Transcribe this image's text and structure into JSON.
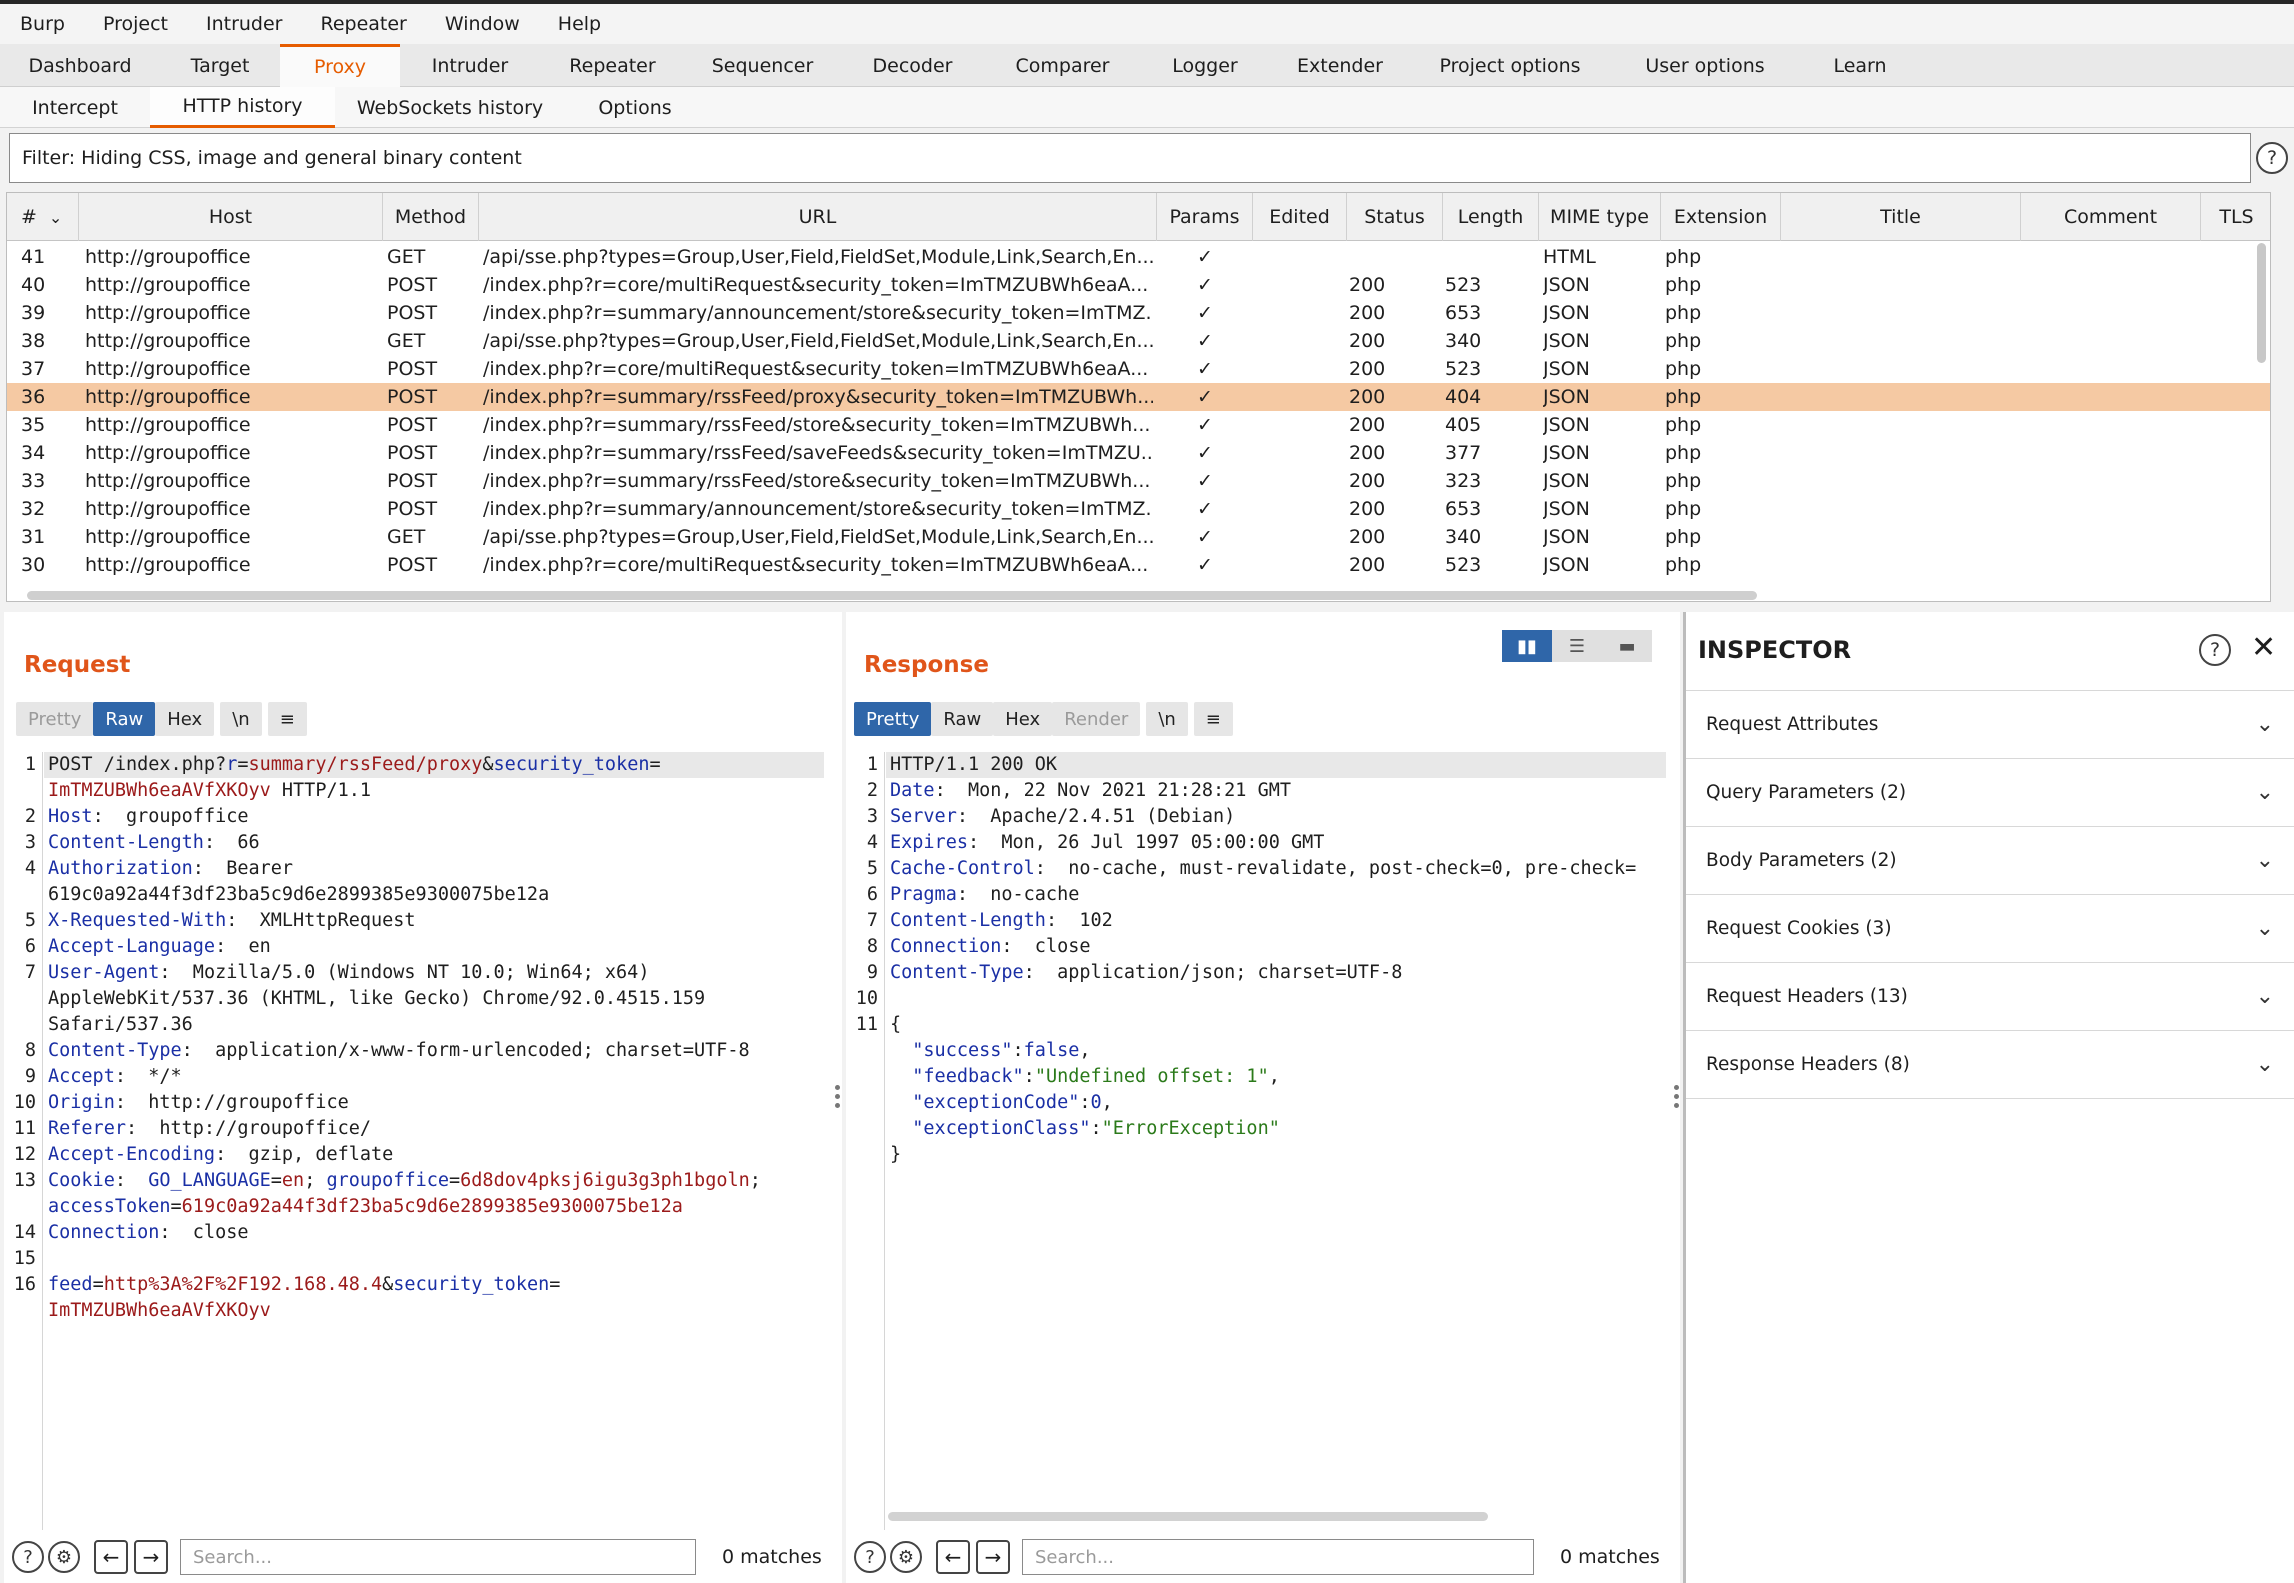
{
  "menu": [
    "Burp",
    "Project",
    "Intruder",
    "Repeater",
    "Window",
    "Help"
  ],
  "main_tabs": [
    {
      "label": "Dashboard",
      "w": 160
    },
    {
      "label": "Target",
      "w": 120
    },
    {
      "label": "Proxy",
      "w": 120,
      "active": true
    },
    {
      "label": "Intruder",
      "w": 140
    },
    {
      "label": "Repeater",
      "w": 145
    },
    {
      "label": "Sequencer",
      "w": 155
    },
    {
      "label": "Decoder",
      "w": 145
    },
    {
      "label": "Comparer",
      "w": 155
    },
    {
      "label": "Logger",
      "w": 130
    },
    {
      "label": "Extender",
      "w": 140
    },
    {
      "label": "Project options",
      "w": 200
    },
    {
      "label": "User options",
      "w": 190
    },
    {
      "label": "Learn",
      "w": 120
    }
  ],
  "sub_tabs": [
    {
      "label": "Intercept",
      "w": 150
    },
    {
      "label": "HTTP history",
      "w": 185,
      "active": true
    },
    {
      "label": "WebSockets history",
      "w": 230
    },
    {
      "label": "Options",
      "w": 140
    }
  ],
  "filter_text": "Filter: Hiding CSS, image and general binary content",
  "columns": {
    "num": "#",
    "host": "Host",
    "method": "Method",
    "url": "URL",
    "params": "Params",
    "edited": "Edited",
    "status": "Status",
    "length": "Length",
    "mime": "MIME type",
    "ext": "Extension",
    "title": "Title",
    "comment": "Comment",
    "tls": "TLS"
  },
  "rows": [
    {
      "num": "41",
      "host": "http://groupoffice",
      "method": "GET",
      "url": "/api/sse.php?types=Group,User,Field,FieldSet,Module,Link,Search,En...",
      "params": "✓",
      "status": "",
      "length": "",
      "mime": "HTML",
      "ext": "php"
    },
    {
      "num": "40",
      "host": "http://groupoffice",
      "method": "POST",
      "url": "/index.php?r=core/multiRequest&security_token=ImTMZUBWh6eaA...",
      "params": "✓",
      "status": "200",
      "length": "523",
      "mime": "JSON",
      "ext": "php"
    },
    {
      "num": "39",
      "host": "http://groupoffice",
      "method": "POST",
      "url": "/index.php?r=summary/announcement/store&security_token=ImTMZ...",
      "params": "✓",
      "status": "200",
      "length": "653",
      "mime": "JSON",
      "ext": "php"
    },
    {
      "num": "38",
      "host": "http://groupoffice",
      "method": "GET",
      "url": "/api/sse.php?types=Group,User,Field,FieldSet,Module,Link,Search,En...",
      "params": "✓",
      "status": "200",
      "length": "340",
      "mime": "JSON",
      "ext": "php"
    },
    {
      "num": "37",
      "host": "http://groupoffice",
      "method": "POST",
      "url": "/index.php?r=core/multiRequest&security_token=ImTMZUBWh6eaA...",
      "params": "✓",
      "status": "200",
      "length": "523",
      "mime": "JSON",
      "ext": "php"
    },
    {
      "num": "36",
      "host": "http://groupoffice",
      "method": "POST",
      "url": "/index.php?r=summary/rssFeed/proxy&security_token=ImTMZUBWh...",
      "params": "✓",
      "status": "200",
      "length": "404",
      "mime": "JSON",
      "ext": "php",
      "selected": true
    },
    {
      "num": "35",
      "host": "http://groupoffice",
      "method": "POST",
      "url": "/index.php?r=summary/rssFeed/store&security_token=ImTMZUBWh...",
      "params": "✓",
      "status": "200",
      "length": "405",
      "mime": "JSON",
      "ext": "php"
    },
    {
      "num": "34",
      "host": "http://groupoffice",
      "method": "POST",
      "url": "/index.php?r=summary/rssFeed/saveFeeds&security_token=ImTMZU...",
      "params": "✓",
      "status": "200",
      "length": "377",
      "mime": "JSON",
      "ext": "php"
    },
    {
      "num": "33",
      "host": "http://groupoffice",
      "method": "POST",
      "url": "/index.php?r=summary/rssFeed/store&security_token=ImTMZUBWh...",
      "params": "✓",
      "status": "200",
      "length": "323",
      "mime": "JSON",
      "ext": "php"
    },
    {
      "num": "32",
      "host": "http://groupoffice",
      "method": "POST",
      "url": "/index.php?r=summary/announcement/store&security_token=ImTMZ...",
      "params": "✓",
      "status": "200",
      "length": "653",
      "mime": "JSON",
      "ext": "php"
    },
    {
      "num": "31",
      "host": "http://groupoffice",
      "method": "GET",
      "url": "/api/sse.php?types=Group,User,Field,FieldSet,Module,Link,Search,En...",
      "params": "✓",
      "status": "200",
      "length": "340",
      "mime": "JSON",
      "ext": "php"
    },
    {
      "num": "30",
      "host": "http://groupoffice",
      "method": "POST",
      "url": "/index.php?r=core/multiRequest&security_token=ImTMZUBWh6eaA...",
      "params": "✓",
      "status": "200",
      "length": "523",
      "mime": "JSON",
      "ext": "php"
    }
  ],
  "request": {
    "title": "Request",
    "buttons": [
      "Pretty",
      "Raw",
      "Hex",
      "\\n",
      "≡"
    ],
    "lines": [
      {
        "n": "1",
        "parts": [
          [
            "t",
            "POST /index.php?"
          ],
          [
            "k",
            "r"
          ],
          [
            "t",
            "="
          ],
          [
            "v",
            "summary/rssFeed/proxy"
          ],
          [
            "t",
            "&"
          ],
          [
            "k",
            "security_token"
          ],
          [
            "t",
            "="
          ]
        ],
        "hl": true
      },
      {
        "n": "",
        "parts": [
          [
            "v",
            "ImTMZUBWh6eaAVfXKOyv"
          ],
          [
            "t",
            " HTTP/1.1"
          ]
        ]
      },
      {
        "n": "2",
        "parts": [
          [
            "k",
            "Host"
          ],
          [
            "t",
            ":  groupoffice"
          ]
        ]
      },
      {
        "n": "3",
        "parts": [
          [
            "k",
            "Content-Length"
          ],
          [
            "t",
            ":  66"
          ]
        ]
      },
      {
        "n": "4",
        "parts": [
          [
            "k",
            "Authorization"
          ],
          [
            "t",
            ":  Bearer"
          ]
        ]
      },
      {
        "n": "",
        "parts": [
          [
            "t",
            "619c0a92a44f3df23ba5c9d6e2899385e9300075be12a"
          ]
        ]
      },
      {
        "n": "5",
        "parts": [
          [
            "k",
            "X-Requested-With"
          ],
          [
            "t",
            ":  XMLHttpRequest"
          ]
        ]
      },
      {
        "n": "6",
        "parts": [
          [
            "k",
            "Accept-Language"
          ],
          [
            "t",
            ":  en"
          ]
        ]
      },
      {
        "n": "7",
        "parts": [
          [
            "k",
            "User-Agent"
          ],
          [
            "t",
            ":  Mozilla/5.0 (Windows NT 10.0; Win64; x64)"
          ]
        ]
      },
      {
        "n": "",
        "parts": [
          [
            "t",
            "AppleWebKit/537.36 (KHTML, like Gecko) Chrome/92.0.4515.159"
          ]
        ]
      },
      {
        "n": "",
        "parts": [
          [
            "t",
            "Safari/537.36"
          ]
        ]
      },
      {
        "n": "8",
        "parts": [
          [
            "k",
            "Content-Type"
          ],
          [
            "t",
            ":  application/x-www-form-urlencoded; charset=UTF-8"
          ]
        ]
      },
      {
        "n": "9",
        "parts": [
          [
            "k",
            "Accept"
          ],
          [
            "t",
            ":  */*"
          ]
        ]
      },
      {
        "n": "10",
        "parts": [
          [
            "k",
            "Origin"
          ],
          [
            "t",
            ":  http://groupoffice"
          ]
        ]
      },
      {
        "n": "11",
        "parts": [
          [
            "k",
            "Referer"
          ],
          [
            "t",
            ":  http://groupoffice/"
          ]
        ]
      },
      {
        "n": "12",
        "parts": [
          [
            "k",
            "Accept-Encoding"
          ],
          [
            "t",
            ":  gzip, deflate"
          ]
        ]
      },
      {
        "n": "13",
        "parts": [
          [
            "k",
            "Cookie"
          ],
          [
            "t",
            ":  "
          ],
          [
            "k",
            "GO_LANGUAGE"
          ],
          [
            "t",
            "="
          ],
          [
            "v",
            "en"
          ],
          [
            "t",
            "; "
          ],
          [
            "k",
            "groupoffice"
          ],
          [
            "t",
            "="
          ],
          [
            "v",
            "6d8dov4pksj6igu3g3ph1bgoln"
          ],
          [
            "t",
            ";"
          ]
        ]
      },
      {
        "n": "",
        "parts": [
          [
            "k",
            "accessToken"
          ],
          [
            "t",
            "="
          ],
          [
            "v",
            "619c0a92a44f3df23ba5c9d6e2899385e9300075be12a"
          ]
        ]
      },
      {
        "n": "14",
        "parts": [
          [
            "k",
            "Connection"
          ],
          [
            "t",
            ":  close"
          ]
        ]
      },
      {
        "n": "15",
        "parts": []
      },
      {
        "n": "16",
        "parts": [
          [
            "k",
            "feed"
          ],
          [
            "t",
            "="
          ],
          [
            "v",
            "http%3A%2F%2F192.168.48.4"
          ],
          [
            "t",
            "&"
          ],
          [
            "k",
            "security_token"
          ],
          [
            "t",
            "="
          ]
        ]
      },
      {
        "n": "",
        "parts": [
          [
            "v",
            "ImTMZUBWh6eaAVfXKOyv"
          ]
        ]
      }
    ],
    "search_placeholder": "Search...",
    "matches": "0 matches"
  },
  "response": {
    "title": "Response",
    "buttons": [
      "Pretty",
      "Raw",
      "Hex",
      "Render",
      "\\n",
      "≡"
    ],
    "lines": [
      {
        "n": "1",
        "parts": [
          [
            "t",
            "HTTP/1.1 200 OK"
          ]
        ],
        "hl": true
      },
      {
        "n": "2",
        "parts": [
          [
            "k",
            "Date"
          ],
          [
            "t",
            ":  Mon, 22 Nov 2021 21:28:21 GMT"
          ]
        ]
      },
      {
        "n": "3",
        "parts": [
          [
            "k",
            "Server"
          ],
          [
            "t",
            ":  Apache/2.4.51 (Debian)"
          ]
        ]
      },
      {
        "n": "4",
        "parts": [
          [
            "k",
            "Expires"
          ],
          [
            "t",
            ":  Mon, 26 Jul 1997 05:00:00 GMT"
          ]
        ]
      },
      {
        "n": "5",
        "parts": [
          [
            "k",
            "Cache-Control"
          ],
          [
            "t",
            ":  no-cache, must-revalidate, post-check=0, pre-check="
          ]
        ]
      },
      {
        "n": "6",
        "parts": [
          [
            "k",
            "Pragma"
          ],
          [
            "t",
            ":  no-cache"
          ]
        ]
      },
      {
        "n": "7",
        "parts": [
          [
            "k",
            "Content-Length"
          ],
          [
            "t",
            ":  102"
          ]
        ]
      },
      {
        "n": "8",
        "parts": [
          [
            "k",
            "Connection"
          ],
          [
            "t",
            ":  close"
          ]
        ]
      },
      {
        "n": "9",
        "parts": [
          [
            "k",
            "Content-Type"
          ],
          [
            "t",
            ":  application/json; charset=UTF-8"
          ]
        ]
      },
      {
        "n": "10",
        "parts": []
      },
      {
        "n": "11",
        "parts": [
          [
            "t",
            "{"
          ]
        ]
      },
      {
        "n": "",
        "parts": [
          [
            "t",
            "  "
          ],
          [
            "k",
            "\"success\""
          ],
          [
            "t",
            ":"
          ],
          [
            "k",
            "false"
          ],
          [
            "t",
            ","
          ]
        ]
      },
      {
        "n": "",
        "parts": [
          [
            "t",
            "  "
          ],
          [
            "k",
            "\"feedback\""
          ],
          [
            "t",
            ":"
          ],
          [
            "s",
            "\"Undefined offset: 1\""
          ],
          [
            "t",
            ","
          ]
        ]
      },
      {
        "n": "",
        "parts": [
          [
            "t",
            "  "
          ],
          [
            "k",
            "\"exceptionCode\""
          ],
          [
            "t",
            ":"
          ],
          [
            "k",
            "0"
          ],
          [
            "t",
            ","
          ]
        ]
      },
      {
        "n": "",
        "parts": [
          [
            "t",
            "  "
          ],
          [
            "k",
            "\"exceptionClass\""
          ],
          [
            "t",
            ":"
          ],
          [
            "s",
            "\"ErrorException\""
          ]
        ]
      },
      {
        "n": "",
        "parts": [
          [
            "t",
            "}"
          ]
        ]
      }
    ],
    "search_placeholder": "Search...",
    "matches": "0 matches"
  },
  "inspector": {
    "title": "INSPECTOR",
    "items": [
      "Request Attributes",
      "Query Parameters (2)",
      "Body Parameters (2)",
      "Request Cookies (3)",
      "Request Headers (13)",
      "Response Headers (8)"
    ]
  }
}
